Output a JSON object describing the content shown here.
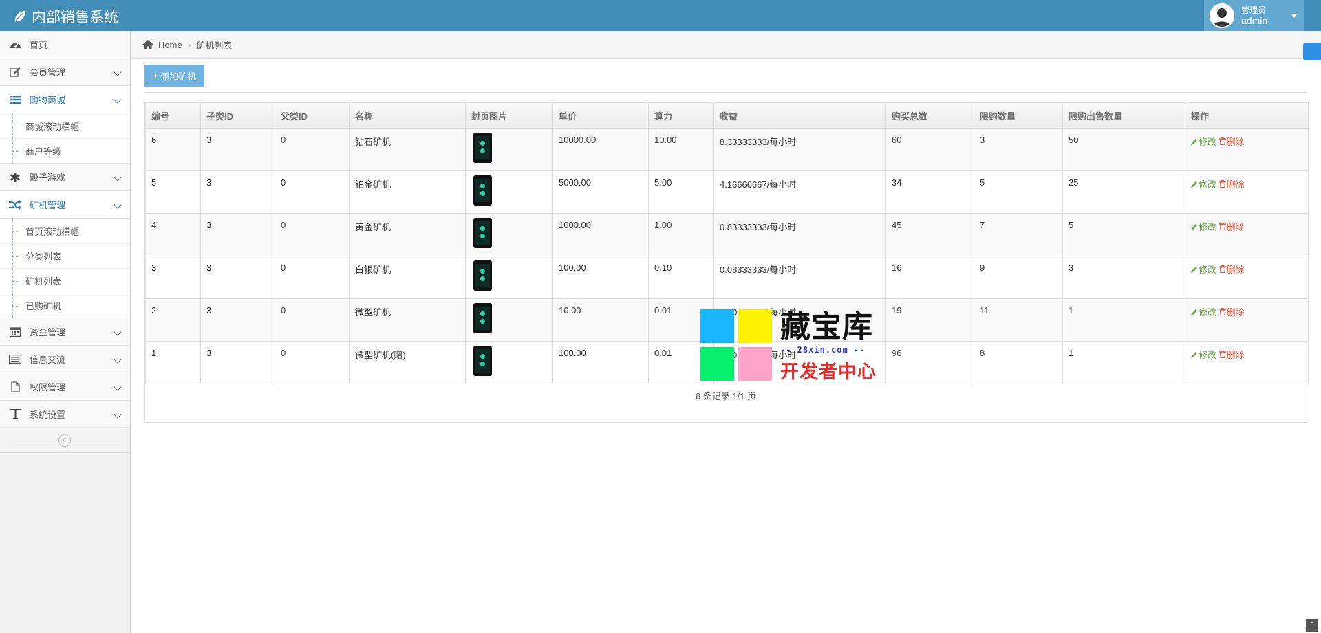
{
  "app": {
    "title": "内部销售系统",
    "user_role": "管理员",
    "user_name": "admin"
  },
  "sidebar": {
    "items": [
      {
        "label": "首页",
        "icon": "dashboard-icon"
      },
      {
        "label": "会员管理",
        "icon": "edit-icon"
      },
      {
        "label": "购物商城",
        "icon": "list-icon",
        "active": true,
        "children": [
          "商城滚动横幅",
          "商户等级"
        ]
      },
      {
        "label": "骰子游戏",
        "icon": "asterisk-icon"
      },
      {
        "label": "矿机管理",
        "icon": "shuffle-icon",
        "active": true,
        "children": [
          "首页滚动横幅",
          "分类列表",
          "矿机列表",
          "已购矿机"
        ]
      },
      {
        "label": "资金管理",
        "icon": "calendar-icon"
      },
      {
        "label": "信息交流",
        "icon": "keyboard-icon"
      },
      {
        "label": "权限管理",
        "icon": "file-icon"
      },
      {
        "label": "系统设置",
        "icon": "text-icon"
      }
    ]
  },
  "breadcrumb": {
    "home": "Home",
    "current": "矿机列表"
  },
  "toolbar": {
    "add_label": "添加矿机"
  },
  "table": {
    "headers": [
      "编号",
      "子类ID",
      "父类ID",
      "名称",
      "封页图片",
      "单价",
      "算力",
      "收益",
      "购买总数",
      "限购数量",
      "限购出售数量",
      "操作"
    ],
    "rows": [
      {
        "id": "6",
        "sub": "3",
        "parent": "0",
        "name": "钻石矿机",
        "price": "10000.00",
        "power": "10.00",
        "income": "8.33333333/每小时",
        "total": "60",
        "limit": "3",
        "limit_sell": "50"
      },
      {
        "id": "5",
        "sub": "3",
        "parent": "0",
        "name": "铂金矿机",
        "price": "5000.00",
        "power": "5.00",
        "income": "4.16666667/每小时",
        "total": "34",
        "limit": "5",
        "limit_sell": "25"
      },
      {
        "id": "4",
        "sub": "3",
        "parent": "0",
        "name": "黄金矿机",
        "price": "1000.00",
        "power": "1.00",
        "income": "0.83333333/每小时",
        "total": "45",
        "limit": "7",
        "limit_sell": "5"
      },
      {
        "id": "3",
        "sub": "3",
        "parent": "0",
        "name": "白银矿机",
        "price": "100.00",
        "power": "0.10",
        "income": "0.08333333/每小时",
        "total": "16",
        "limit": "9",
        "limit_sell": "3"
      },
      {
        "id": "2",
        "sub": "3",
        "parent": "0",
        "name": "微型矿机",
        "price": "10.00",
        "power": "0.01",
        "income": "0.00833333/每小时",
        "total": "19",
        "limit": "11",
        "limit_sell": "1"
      },
      {
        "id": "1",
        "sub": "3",
        "parent": "0",
        "name": "微型矿机(赠)",
        "price": "100.00",
        "power": "0.01",
        "income": "0.00833330/每小时",
        "total": "96",
        "limit": "8",
        "limit_sell": "1"
      }
    ],
    "op_edit": "修改",
    "op_delete": "删除"
  },
  "pagination": {
    "text": "6 条记录 1/1 页"
  },
  "watermark": {
    "title": "藏宝库",
    "url": "-- 28xin.com --",
    "subtitle": "开发者中心"
  },
  "colors": {
    "navbar": "#438eb9",
    "accent": "#2b7dbc",
    "edit": "#69aa46",
    "delete": "#dd5a43",
    "button": "#6fb3e0"
  }
}
